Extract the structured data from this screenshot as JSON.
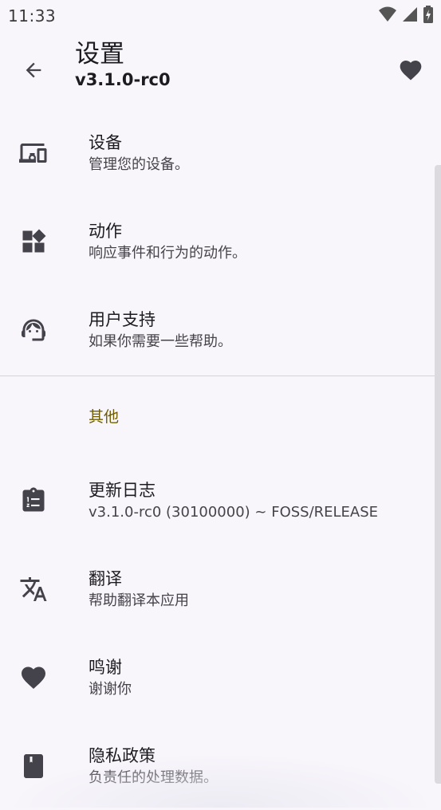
{
  "status_bar": {
    "time": "11:33"
  },
  "app_bar": {
    "title": "设置",
    "subtitle": "v3.1.0-rc0"
  },
  "items_main": [
    {
      "label": "设备",
      "desc": "管理您的设备。",
      "icon": "devices-icon"
    },
    {
      "label": "动作",
      "desc": "响应事件和行为的动作。",
      "icon": "widgets-icon"
    },
    {
      "label": "用户支持",
      "desc": "如果你需要一些帮助。",
      "icon": "support-agent-icon"
    }
  ],
  "section_other": {
    "header": "其他"
  },
  "items_other": [
    {
      "label": "更新日志",
      "desc": "v3.1.0-rc0 (30100000) ~ FOSS/RELEASE",
      "icon": "changelog-icon"
    },
    {
      "label": "翻译",
      "desc": "帮助翻译本应用",
      "icon": "translate-icon"
    },
    {
      "label": "鸣谢",
      "desc": "谢谢你",
      "icon": "heart-icon"
    },
    {
      "label": "隐私政策",
      "desc": "负责任的处理数据。",
      "icon": "book-icon"
    }
  ],
  "colors": {
    "background": "#f8f6fb",
    "section_header": "#6e5d00",
    "icon": "#44424a"
  }
}
